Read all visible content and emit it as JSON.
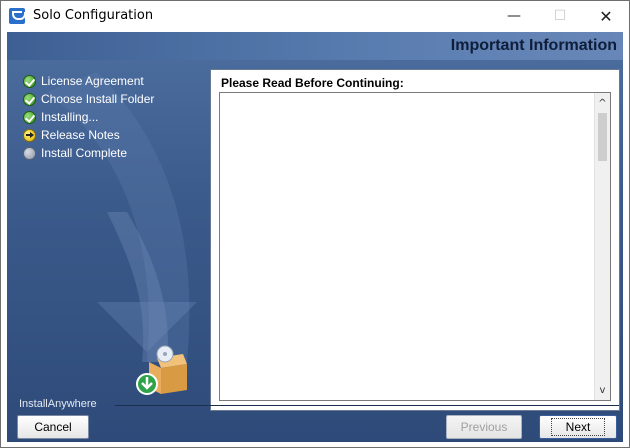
{
  "window": {
    "title": "Solo Configuration",
    "minimize_glyph": "—",
    "maximize_glyph": "☐",
    "close_glyph": "✕"
  },
  "header": {
    "title": "Important Information"
  },
  "steps": [
    {
      "label": "License Agreement",
      "state": "done"
    },
    {
      "label": "Choose Install Folder",
      "state": "done"
    },
    {
      "label": "Installing...",
      "state": "done"
    },
    {
      "label": "Release Notes",
      "state": "current"
    },
    {
      "label": "Install Complete",
      "state": "pending"
    }
  ],
  "panel": {
    "heading": "Please Read Before Continuing:",
    "text": "",
    "scroll_up_glyph": "^",
    "scroll_down_glyph": "v"
  },
  "footer": {
    "brand": "InstallAnywhere",
    "cancel_label": "Cancel",
    "previous_label": "Previous",
    "next_label": "Next"
  },
  "colors": {
    "panel_bg": "#3b5b8c",
    "header_text": "#0e1e3a",
    "step_text": "#ffffff",
    "done_icon": "#2f8a1c",
    "current_icon": "#e0b000"
  }
}
